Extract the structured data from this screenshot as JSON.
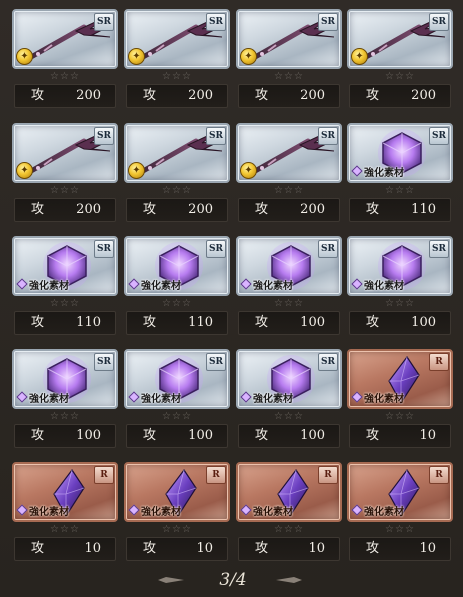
{
  "star_glyphs": "☆☆☆",
  "stat_label": "攻",
  "material_label": "強化素材",
  "rows": [
    [
      {
        "kind": "weapon",
        "rarity": "SR",
        "coin": true,
        "value": "200"
      },
      {
        "kind": "weapon",
        "rarity": "SR",
        "coin": true,
        "value": "200"
      },
      {
        "kind": "weapon",
        "rarity": "SR",
        "coin": true,
        "value": "200"
      },
      {
        "kind": "weapon",
        "rarity": "SR",
        "coin": true,
        "value": "200"
      }
    ],
    [
      {
        "kind": "weapon",
        "rarity": "SR",
        "coin": true,
        "value": "200"
      },
      {
        "kind": "weapon",
        "rarity": "SR",
        "coin": true,
        "value": "200"
      },
      {
        "kind": "weapon",
        "rarity": "SR",
        "coin": true,
        "value": "200"
      },
      {
        "kind": "material-cube",
        "rarity": "SR",
        "coin": false,
        "value": "110"
      }
    ],
    [
      {
        "kind": "material-cube",
        "rarity": "SR",
        "coin": false,
        "value": "110"
      },
      {
        "kind": "material-cube",
        "rarity": "SR",
        "coin": false,
        "value": "110"
      },
      {
        "kind": "material-cube",
        "rarity": "SR",
        "coin": false,
        "value": "100"
      },
      {
        "kind": "material-cube",
        "rarity": "SR",
        "coin": false,
        "value": "100"
      }
    ],
    [
      {
        "kind": "material-cube",
        "rarity": "SR",
        "coin": false,
        "value": "100"
      },
      {
        "kind": "material-cube",
        "rarity": "SR",
        "coin": false,
        "value": "100"
      },
      {
        "kind": "material-cube",
        "rarity": "SR",
        "coin": false,
        "value": "100"
      },
      {
        "kind": "material-crystal",
        "rarity": "R",
        "coin": false,
        "value": "10"
      }
    ],
    [
      {
        "kind": "material-crystal",
        "rarity": "R",
        "coin": false,
        "value": "10"
      },
      {
        "kind": "material-crystal",
        "rarity": "R",
        "coin": false,
        "value": "10"
      },
      {
        "kind": "material-crystal",
        "rarity": "R",
        "coin": false,
        "value": "10"
      },
      {
        "kind": "material-crystal",
        "rarity": "R",
        "coin": false,
        "value": "10"
      }
    ]
  ],
  "pager": {
    "indicator": "3/4",
    "prev_icon": "left-ornament-arrow-icon",
    "next_icon": "right-ornament-arrow-icon"
  },
  "colors": {
    "background": "#2b2723",
    "sr_frame": "#9aa6b1",
    "r_frame": "#a66a52",
    "stat_text": "#f1ede6",
    "material_glow": "#b77cf0"
  }
}
